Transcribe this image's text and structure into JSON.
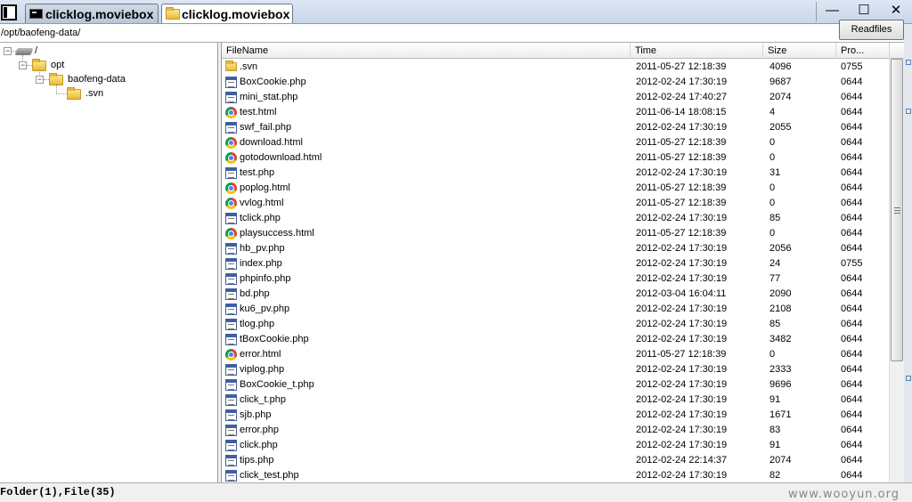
{
  "tabs": [
    {
      "label": "clicklog.moviebox",
      "icon": "cmd-icon",
      "active": false
    },
    {
      "label": "clicklog.moviebox",
      "icon": "folder-icon",
      "active": true
    }
  ],
  "window_buttons": {
    "minimize": "—",
    "maximize": "☐",
    "close": "✕"
  },
  "address": {
    "path": "/opt/baofeng-data/",
    "button_label": "Readfiles"
  },
  "tree": {
    "nodes": [
      {
        "label": "/",
        "icon": "drive-icon",
        "expanded": true
      },
      {
        "label": "opt",
        "icon": "folder-icon",
        "expanded": true
      },
      {
        "label": "baofeng-data",
        "icon": "folder-icon",
        "expanded": true
      },
      {
        "label": ".svn",
        "icon": "folder-icon",
        "expanded": false
      }
    ],
    "expanded_marker": "−"
  },
  "columns": [
    "FileName",
    "Time",
    "Size",
    "Pro..."
  ],
  "files": [
    {
      "name": ".svn",
      "time": "2011-05-27 12:18:39",
      "size": "4096",
      "perm": "0755",
      "icon": "folder-icon"
    },
    {
      "name": "BoxCookie.php",
      "time": "2012-02-24 17:30:19",
      "size": "9687",
      "perm": "0644",
      "icon": "php-file-icon"
    },
    {
      "name": "mini_stat.php",
      "time": "2012-02-24 17:40:27",
      "size": "2074",
      "perm": "0644",
      "icon": "php-file-icon"
    },
    {
      "name": "test.html",
      "time": "2011-06-14 18:08:15",
      "size": "4",
      "perm": "0644",
      "icon": "html-file-icon"
    },
    {
      "name": "swf_fail.php",
      "time": "2012-02-24 17:30:19",
      "size": "2055",
      "perm": "0644",
      "icon": "php-file-icon"
    },
    {
      "name": "download.html",
      "time": "2011-05-27 12:18:39",
      "size": "0",
      "perm": "0644",
      "icon": "html-file-icon"
    },
    {
      "name": "gotodownload.html",
      "time": "2011-05-27 12:18:39",
      "size": "0",
      "perm": "0644",
      "icon": "html-file-icon"
    },
    {
      "name": "test.php",
      "time": "2012-02-24 17:30:19",
      "size": "31",
      "perm": "0644",
      "icon": "php-file-icon"
    },
    {
      "name": "poplog.html",
      "time": "2011-05-27 12:18:39",
      "size": "0",
      "perm": "0644",
      "icon": "html-file-icon"
    },
    {
      "name": "vvlog.html",
      "time": "2011-05-27 12:18:39",
      "size": "0",
      "perm": "0644",
      "icon": "html-file-icon"
    },
    {
      "name": "tclick.php",
      "time": "2012-02-24 17:30:19",
      "size": "85",
      "perm": "0644",
      "icon": "php-file-icon"
    },
    {
      "name": "playsuccess.html",
      "time": "2011-05-27 12:18:39",
      "size": "0",
      "perm": "0644",
      "icon": "html-file-icon"
    },
    {
      "name": "hb_pv.php",
      "time": "2012-02-24 17:30:19",
      "size": "2056",
      "perm": "0644",
      "icon": "php-file-icon"
    },
    {
      "name": "index.php",
      "time": "2012-02-24 17:30:19",
      "size": "24",
      "perm": "0755",
      "icon": "php-file-icon"
    },
    {
      "name": "phpinfo.php",
      "time": "2012-02-24 17:30:19",
      "size": "77",
      "perm": "0644",
      "icon": "php-file-icon"
    },
    {
      "name": "bd.php",
      "time": "2012-03-04 16:04:11",
      "size": "2090",
      "perm": "0644",
      "icon": "php-file-icon"
    },
    {
      "name": "ku6_pv.php",
      "time": "2012-02-24 17:30:19",
      "size": "2108",
      "perm": "0644",
      "icon": "php-file-icon"
    },
    {
      "name": "tlog.php",
      "time": "2012-02-24 17:30:19",
      "size": "85",
      "perm": "0644",
      "icon": "php-file-icon"
    },
    {
      "name": "tBoxCookie.php",
      "time": "2012-02-24 17:30:19",
      "size": "3482",
      "perm": "0644",
      "icon": "php-file-icon"
    },
    {
      "name": "error.html",
      "time": "2011-05-27 12:18:39",
      "size": "0",
      "perm": "0644",
      "icon": "html-file-icon"
    },
    {
      "name": "viplog.php",
      "time": "2012-02-24 17:30:19",
      "size": "2333",
      "perm": "0644",
      "icon": "php-file-icon"
    },
    {
      "name": "BoxCookie_t.php",
      "time": "2012-02-24 17:30:19",
      "size": "9696",
      "perm": "0644",
      "icon": "php-file-icon"
    },
    {
      "name": "click_t.php",
      "time": "2012-02-24 17:30:19",
      "size": "91",
      "perm": "0644",
      "icon": "php-file-icon"
    },
    {
      "name": "sjb.php",
      "time": "2012-02-24 17:30:19",
      "size": "1671",
      "perm": "0644",
      "icon": "php-file-icon"
    },
    {
      "name": "error.php",
      "time": "2012-02-24 17:30:19",
      "size": "83",
      "perm": "0644",
      "icon": "php-file-icon"
    },
    {
      "name": "click.php",
      "time": "2012-02-24 17:30:19",
      "size": "91",
      "perm": "0644",
      "icon": "php-file-icon"
    },
    {
      "name": "tips.php",
      "time": "2012-02-24 22:14:37",
      "size": "2074",
      "perm": "0644",
      "icon": "php-file-icon"
    },
    {
      "name": "click_test.php",
      "time": "2012-02-24 17:30:19",
      "size": "82",
      "perm": "0644",
      "icon": "php-file-icon"
    }
  ],
  "status": {
    "summary": "Folder(1),File(35)",
    "watermark": "www.wooyun.org"
  }
}
